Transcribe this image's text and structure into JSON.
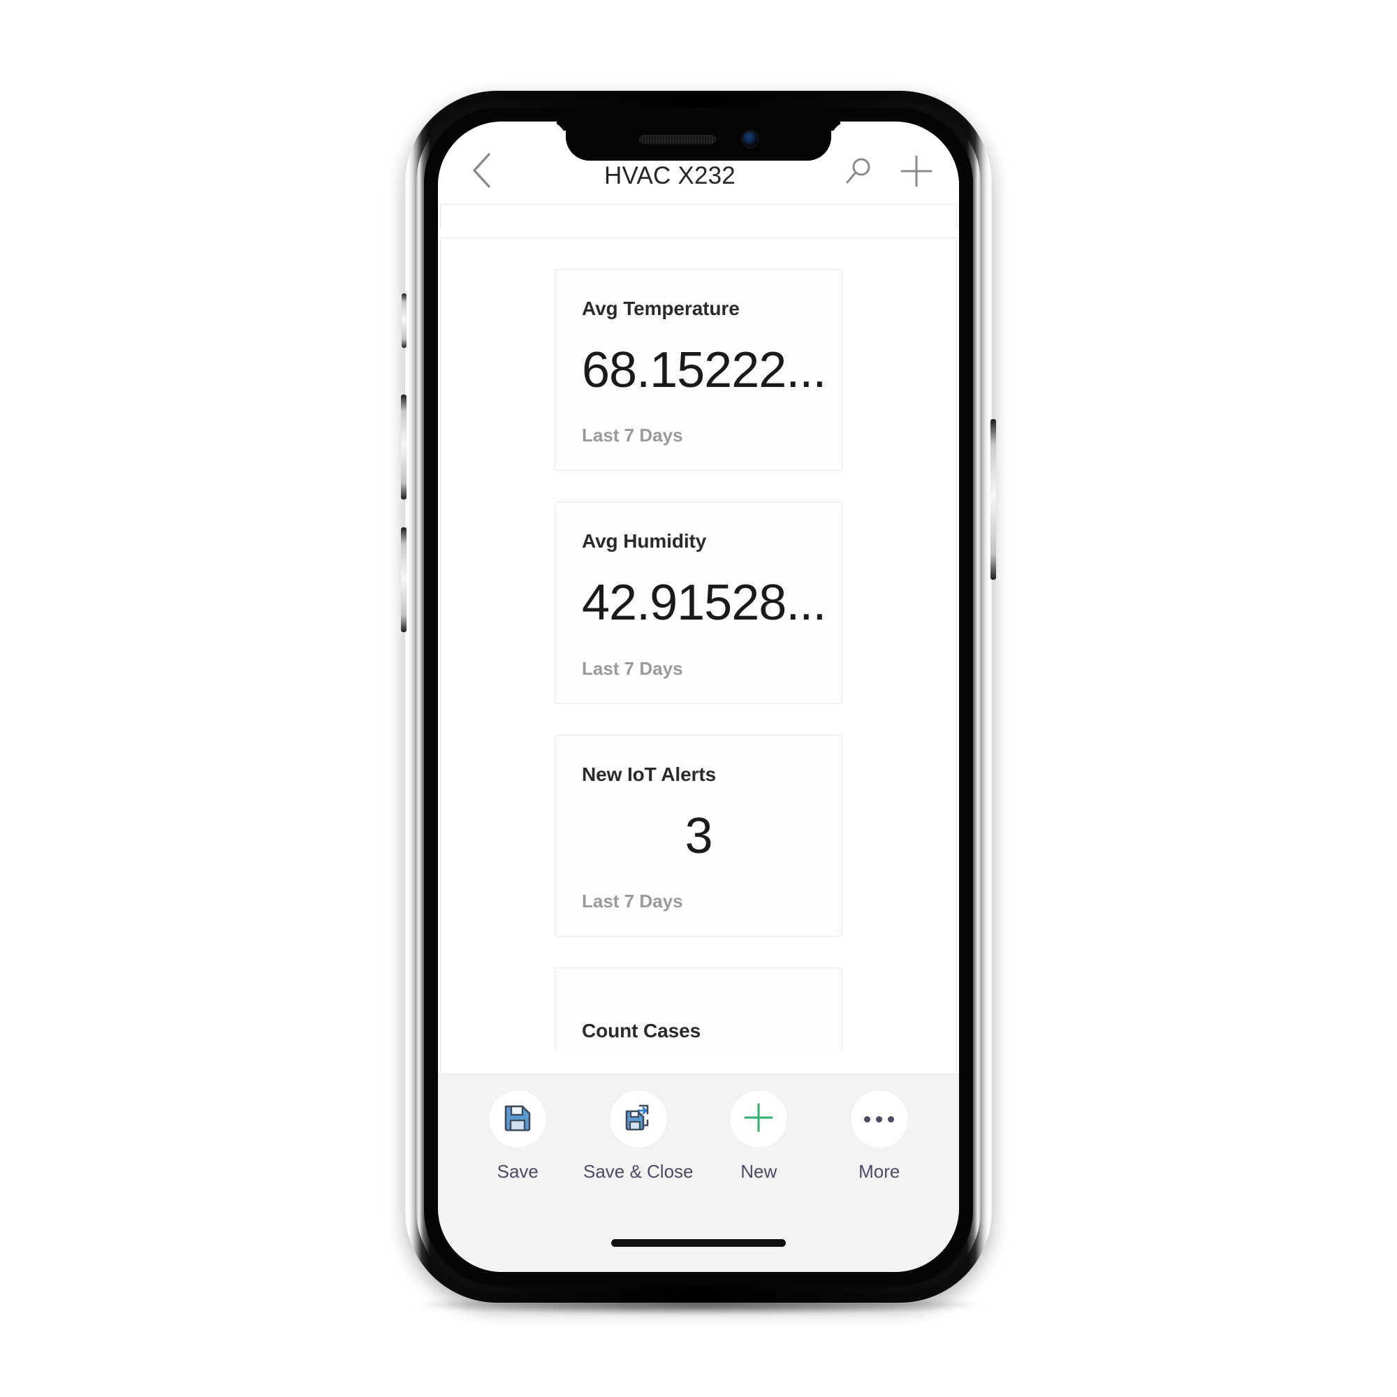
{
  "appbar": {
    "back_icon": "chevron-left-icon",
    "title": "HVAC X232",
    "search_icon": "search-icon",
    "add_icon": "plus-icon"
  },
  "cards": [
    {
      "title": "Avg Temperature",
      "value": "68.15222...",
      "footer": "Last 7 Days",
      "align": "left"
    },
    {
      "title": "Avg Humidity",
      "value": "42.91528...",
      "footer": "Last 7 Days",
      "align": "left"
    },
    {
      "title": "New IoT Alerts",
      "value": "3",
      "footer": "Last 7 Days",
      "align": "center"
    },
    {
      "title": "Count Cases",
      "value": "",
      "footer": "",
      "align": "left"
    }
  ],
  "commandbar": {
    "items": [
      {
        "label": "Save",
        "icon": "floppy-disk-icon"
      },
      {
        "label": "Save & Close",
        "icon": "floppy-disk-arrow-icon"
      },
      {
        "label": "New",
        "icon": "plus-icon"
      },
      {
        "label": "More",
        "icon": "ellipsis-icon"
      }
    ]
  },
  "colors": {
    "accent_green": "#3bb273",
    "floppy_blue": "#5b9bd5",
    "label_text": "#4b4b66",
    "title_text": "#262626",
    "muted_text": "#9a9a9a"
  },
  "device": {
    "speaker": "earpiece-speaker",
    "camera": "front-camera",
    "home_indicator": "home-indicator"
  }
}
